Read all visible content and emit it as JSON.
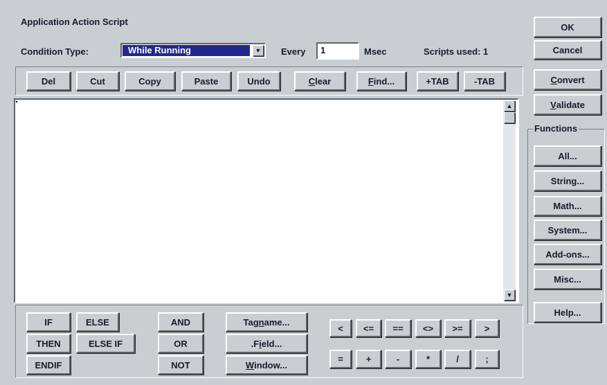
{
  "window": {
    "title": "Application Action Script"
  },
  "condition": {
    "label": "Condition Type:",
    "selected": "While Running",
    "every_label": "Every",
    "every_value": "1",
    "msec_label": "Msec",
    "scripts_used": "Scripts used: 1"
  },
  "toolbar": {
    "del": "Del",
    "cut": "Cut",
    "copy": "Copy",
    "paste": "Paste",
    "undo": "Undo",
    "clear_pre": "",
    "clear_u": "C",
    "clear_post": "lear",
    "find_pre": "",
    "find_u": "F",
    "find_post": "ind...",
    "add_tab": "+TAB",
    "remove_tab": "-TAB"
  },
  "side": {
    "ok": "OK",
    "cancel": "Cancel",
    "convert_u": "C",
    "convert_post": "onvert",
    "validate_u": "V",
    "validate_post": "alidate",
    "functions_label": "Functions",
    "all": "All...",
    "string": "String...",
    "math": "Math...",
    "system": "System...",
    "addons": "Add-ons...",
    "misc": "Misc...",
    "help": "Help..."
  },
  "editor": {
    "content": ""
  },
  "keywords": {
    "if": "IF",
    "else": "ELSE",
    "then": "THEN",
    "else_if": "ELSE IF",
    "endif": "ENDIF",
    "and": "AND",
    "or": "OR",
    "not": "NOT"
  },
  "tags": {
    "tagname_pre": "Tag",
    "tagname_u": "n",
    "tagname_post": "ame...",
    "field_pre": ".F",
    "field_u": "i",
    "field_post": "eld...",
    "window_pre": "",
    "window_u": "W",
    "window_post": "indow..."
  },
  "operators": {
    "lt": "<",
    "le": "<=",
    "eq": "==",
    "ne": "<>",
    "ge": ">=",
    "gt": ">",
    "assign": "=",
    "plus": "+",
    "minus": "-",
    "mult": "*",
    "div": "/",
    "semicolon": ";"
  },
  "colors": {
    "face": "#c9ced2",
    "select_bg": "#1f2a8c",
    "editor_bg": "#ffffff"
  }
}
